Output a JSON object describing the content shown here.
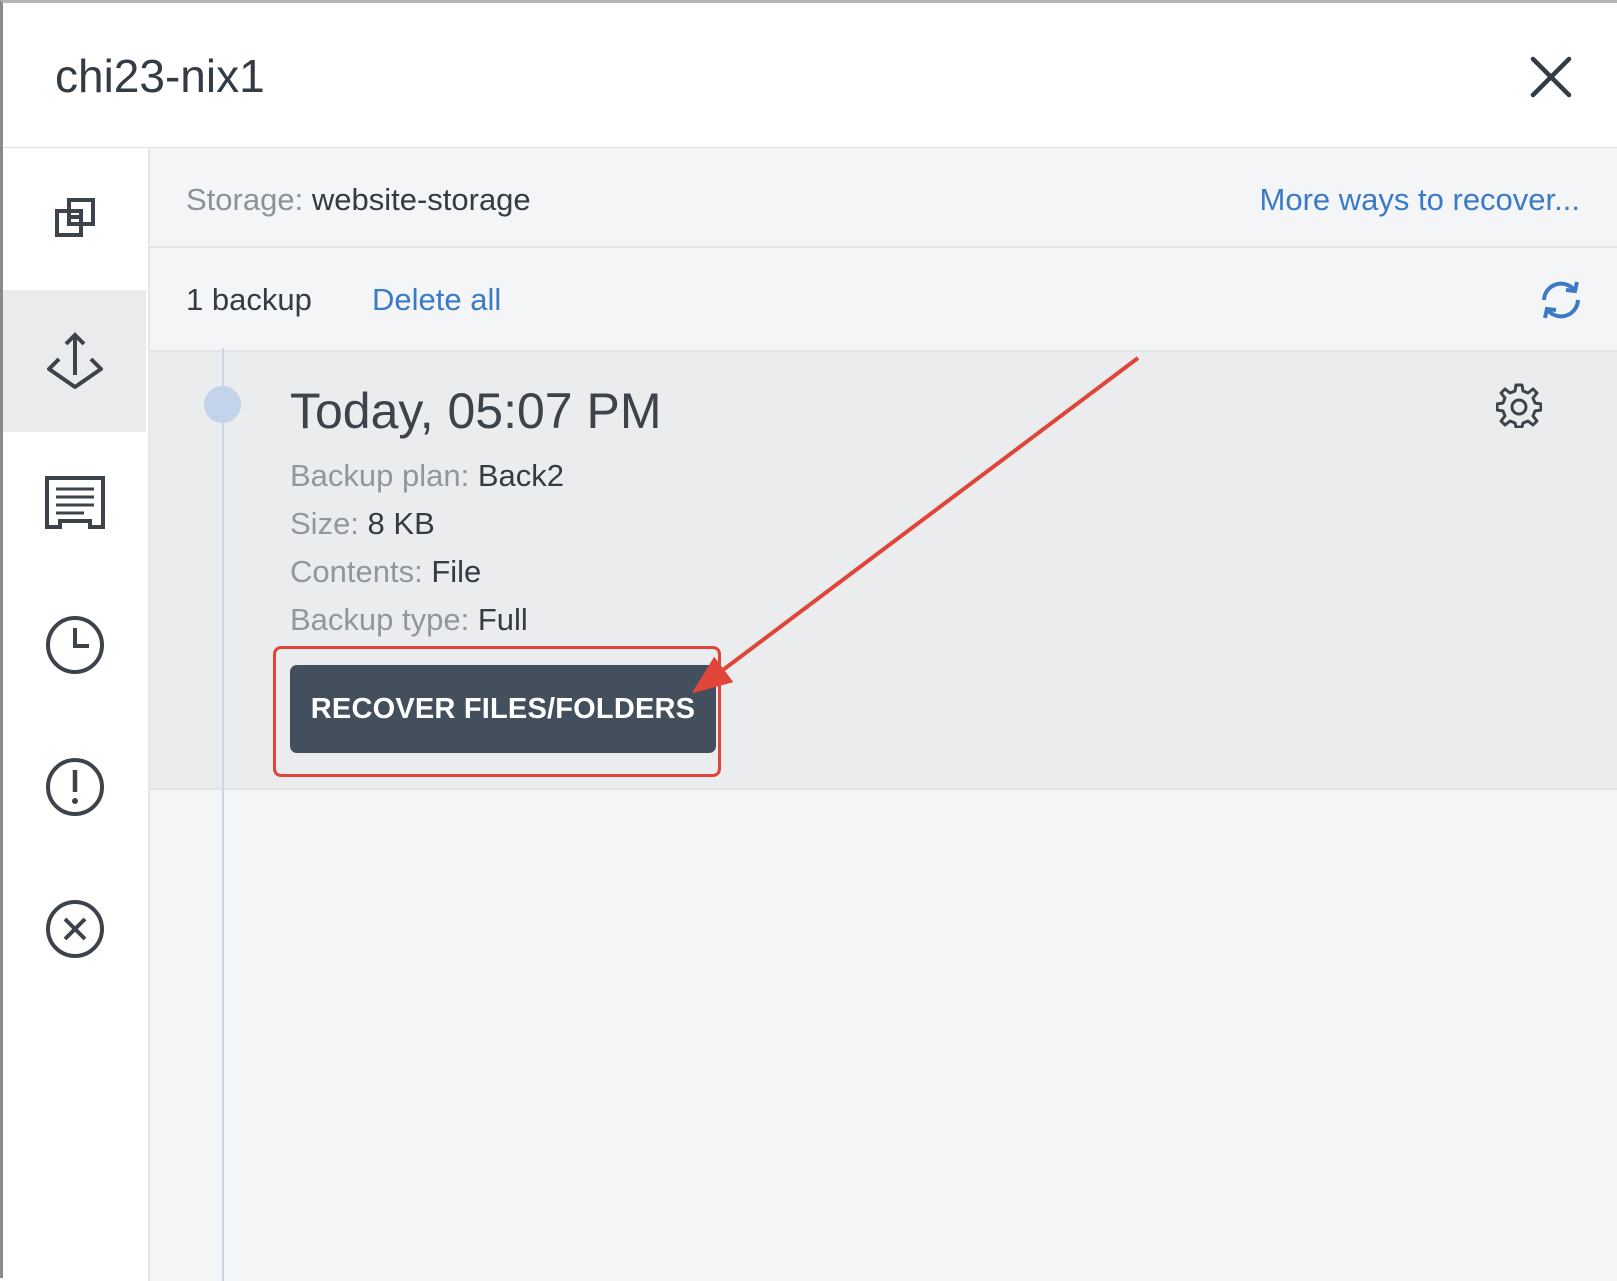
{
  "header": {
    "title": "chi23-nix1"
  },
  "sidebar": {
    "items": [
      {
        "icon": "copy-icon"
      },
      {
        "icon": "anchor-icon",
        "active": true
      },
      {
        "icon": "report-icon"
      },
      {
        "icon": "clock-icon"
      },
      {
        "icon": "alert-icon"
      },
      {
        "icon": "cancel-icon"
      }
    ]
  },
  "storage_bar": {
    "label": "Storage:",
    "value": "website-storage",
    "more_ways": "More ways to recover..."
  },
  "backup_bar": {
    "count": "1 backup",
    "delete_all": "Delete all"
  },
  "backup_entry": {
    "time": "Today, 05:07 PM",
    "details": [
      {
        "label": "Backup plan:",
        "value": "Back2"
      },
      {
        "label": "Size:",
        "value": "8 KB"
      },
      {
        "label": "Contents:",
        "value": "File"
      },
      {
        "label": "Backup type:",
        "value": "Full"
      }
    ],
    "recover_button": "RECOVER FILES/FOLDERS"
  },
  "colors": {
    "link": "#3b7bc6",
    "button": "#434f5d",
    "annotation": "#e0453a",
    "timeline_dot": "#c3d4ea"
  }
}
